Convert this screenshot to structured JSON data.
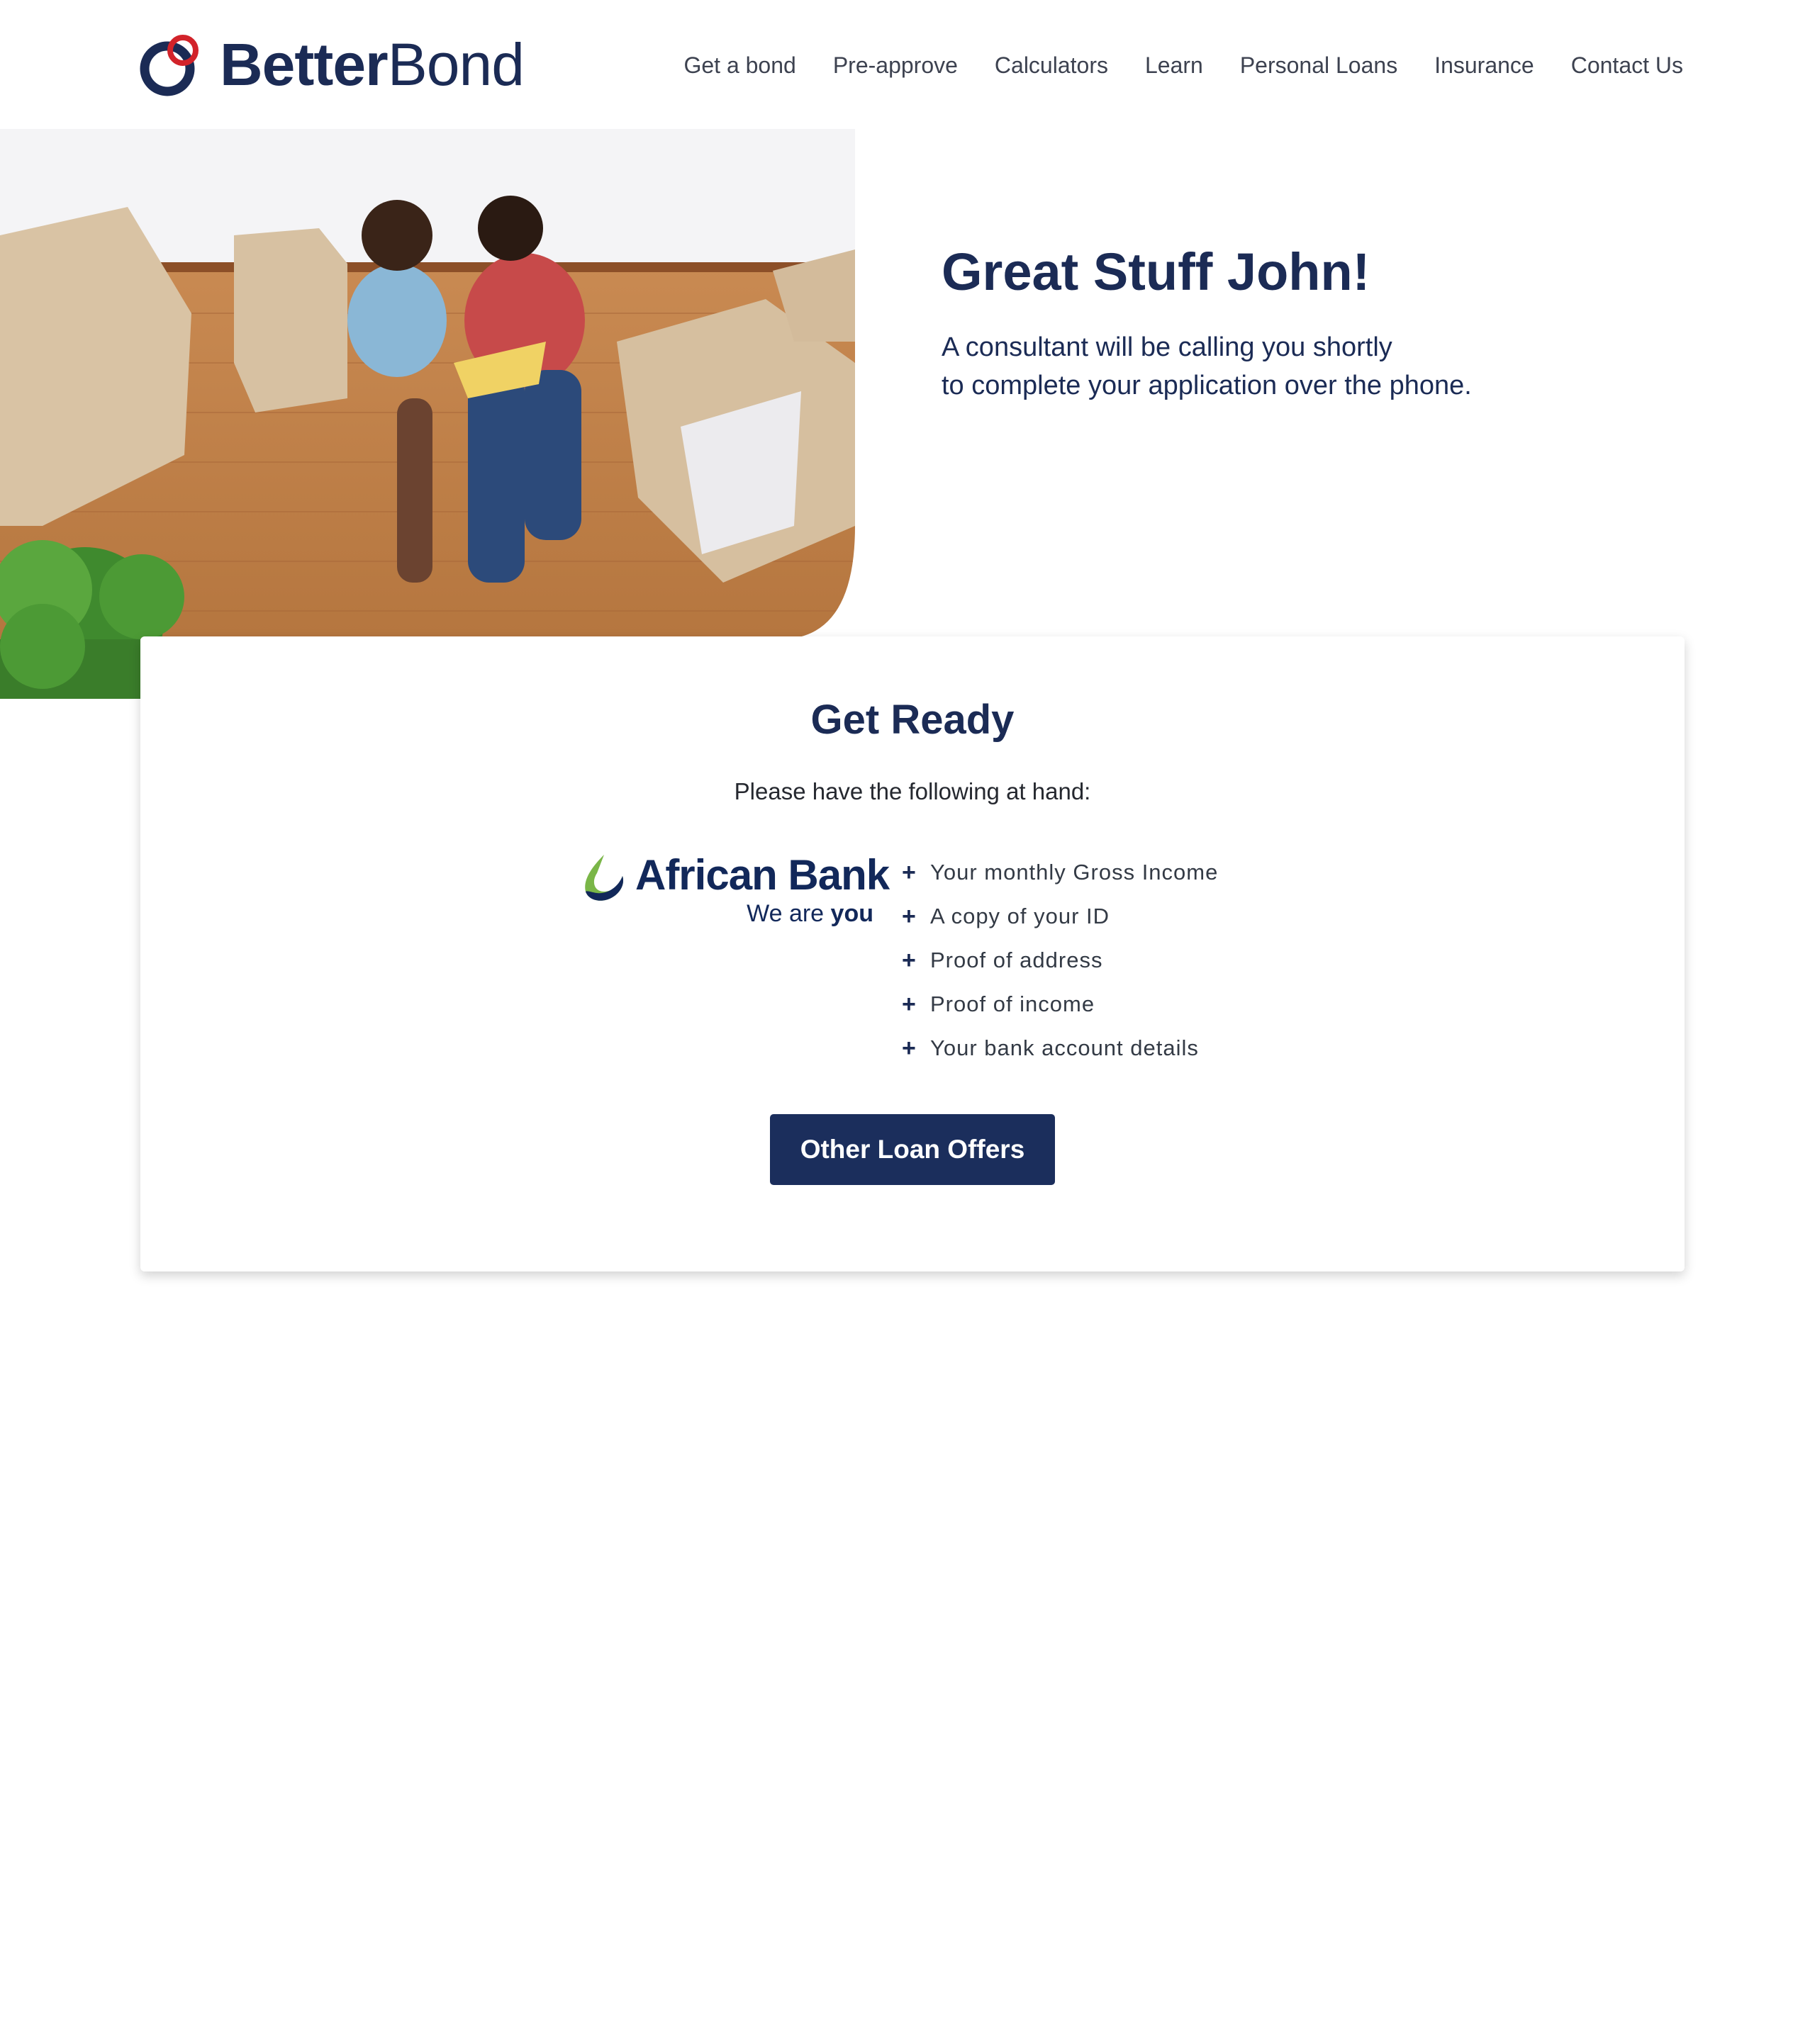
{
  "brand": {
    "better": "Better",
    "bond": "Bond"
  },
  "nav": [
    {
      "label": "Get a bond"
    },
    {
      "label": "Pre-approve"
    },
    {
      "label": "Calculators"
    },
    {
      "label": "Learn"
    },
    {
      "label": "Personal Loans"
    },
    {
      "label": "Insurance"
    },
    {
      "label": "Contact Us"
    }
  ],
  "hero": {
    "title": "Great Stuff John!",
    "subtitle_line1": "A consultant will be calling you shortly",
    "subtitle_line2": "to complete your application over the phone."
  },
  "card": {
    "title": "Get Ready",
    "subtitle": "Please have the following at hand:",
    "partner": {
      "name": "African Bank",
      "tag_prefix": "We are",
      "tag_emph": "you"
    },
    "items": [
      "Your monthly Gross Income",
      "A copy of your ID",
      "Proof of address",
      "Proof of income",
      "Your bank account details"
    ],
    "button_label": "Other Loan Offers"
  },
  "colors": {
    "navy": "#1b2b55",
    "accent_red": "#d2232a",
    "african_bank_green": "#7ab648",
    "button_bg": "#1b2e5c"
  }
}
